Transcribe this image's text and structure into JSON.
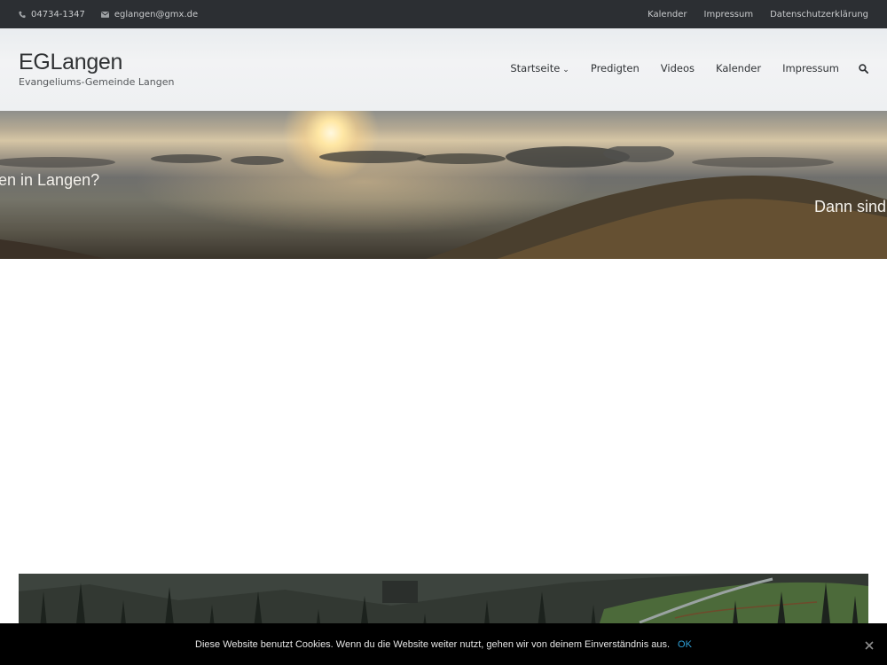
{
  "topbar": {
    "phone": "04734-1347",
    "email": "eglangen@gmx.de",
    "links": [
      "Kalender",
      "Impressum",
      "Datenschutzerklärung"
    ]
  },
  "header": {
    "site_title": "EGLangen",
    "tagline": "Evangeliums-Gemeinde Langen"
  },
  "nav": {
    "items": [
      "Startseite",
      "Predigten",
      "Videos",
      "Kalender",
      "Impressum"
    ],
    "dropdown_indicator": "⌄"
  },
  "hero": {
    "caption_left": "en in Langen?",
    "caption_right": "Dann sind"
  },
  "cookie": {
    "message": "Diese Website benutzt Cookies. Wenn du die Website weiter nutzt, gehen wir von deinem Einverständnis aus.",
    "ok_label": "OK"
  },
  "icons": {
    "phone": "phone-icon",
    "email": "envelope-icon",
    "search": "search-icon",
    "close": "close-icon"
  },
  "colors": {
    "topbar_bg": "#2c2f33",
    "cookie_bg": "#000000",
    "ok_link": "#2f9fd6"
  }
}
